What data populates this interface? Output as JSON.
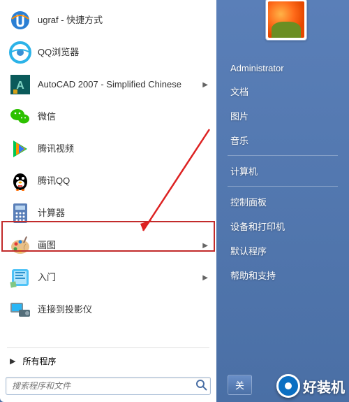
{
  "user": {
    "name": "Administrator"
  },
  "programs": [
    {
      "label": "ugraf - 快捷方式",
      "icon": "ugraf-icon",
      "hasSubmenu": false
    },
    {
      "label": "QQ浏览器",
      "icon": "qqbrowser-icon",
      "hasSubmenu": false
    },
    {
      "label": "AutoCAD 2007 - Simplified Chinese",
      "icon": "autocad-icon",
      "hasSubmenu": true
    },
    {
      "label": "微信",
      "icon": "wechat-icon",
      "hasSubmenu": false
    },
    {
      "label": "腾讯视频",
      "icon": "tencentvideo-icon",
      "hasSubmenu": false
    },
    {
      "label": "腾讯QQ",
      "icon": "qq-icon",
      "hasSubmenu": false
    },
    {
      "label": "计算器",
      "icon": "calculator-icon",
      "hasSubmenu": false
    },
    {
      "label": "画图",
      "icon": "paint-icon",
      "hasSubmenu": true
    },
    {
      "label": "入门",
      "icon": "gettingstarted-icon",
      "hasSubmenu": true
    },
    {
      "label": "连接到投影仪",
      "icon": "projector-icon",
      "hasSubmenu": false
    }
  ],
  "allPrograms": {
    "label": "所有程序"
  },
  "search": {
    "placeholder": "搜索程序和文件"
  },
  "rightMenu": [
    {
      "label": "文档"
    },
    {
      "label": "图片"
    },
    {
      "label": "音乐"
    },
    {
      "sep": true
    },
    {
      "label": "计算机"
    },
    {
      "sep": true
    },
    {
      "label": "控制面板"
    },
    {
      "label": "设备和打印机"
    },
    {
      "label": "默认程序"
    },
    {
      "label": "帮助和支持"
    }
  ],
  "shutdown": {
    "label": "关"
  },
  "watermark": {
    "text": "好装机"
  },
  "highlightIndex": 7
}
